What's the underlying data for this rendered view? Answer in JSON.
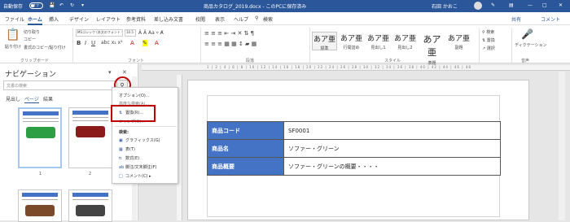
{
  "titlebar": {
    "autosave": "自動保存",
    "autosave_state": "オフ",
    "title": "商品カタログ_2019.docx - このPCに保存済み",
    "user": "石田 かおこ",
    "accent": "#2b579a"
  },
  "menu": {
    "items": [
      "ファイル",
      "ホーム",
      "挿入",
      "デザイン",
      "レイアウト",
      "参考資料",
      "差し込み文書",
      "校閲",
      "表示",
      "ヘルプ",
      "検索"
    ],
    "active": "ホーム",
    "share": "共有",
    "comment": "コメント"
  },
  "ribbon": {
    "clipboard": {
      "paste": "貼り付け",
      "cut": "切り取り",
      "copy": "コピー",
      "format_painter": "書式のコピー/貼り付け",
      "label": "クリップボード"
    },
    "font": {
      "name": "MSゴシック (本文のフォント - 日本語)",
      "size": "10.5",
      "label": "フォント"
    },
    "paragraph": {
      "label": "段落"
    },
    "styles": {
      "label": "スタイル",
      "items": [
        {
          "big": "あア亜",
          "small": "標準"
        },
        {
          "big": "あア亜",
          "small": "行間詰め"
        },
        {
          "big": "あア亜",
          "small": "見出し1"
        },
        {
          "big": "あア亜",
          "small": "見出し2"
        },
        {
          "big": "あア亜",
          "small": "表題"
        },
        {
          "big": "あア亜",
          "small": "副題"
        }
      ]
    },
    "editing": {
      "find": "検索",
      "replace": "置換",
      "select": "選択"
    },
    "voice": {
      "dictate": "ディクテーション",
      "label": "音声"
    }
  },
  "nav": {
    "title": "ナビゲーション",
    "search_placeholder": "文書の検索",
    "tabs": [
      "見出し",
      "ページ",
      "結果"
    ],
    "active_tab": "ページ",
    "page_numbers": [
      "1",
      "2"
    ]
  },
  "search_menu": {
    "options": "オプション(O)...",
    "advanced_find": "高度な検索(A)...",
    "replace": "置換(R)...",
    "goto": "ジャンプ(G)...",
    "find_header": "検索:",
    "graphics": "グラフィックス(G)",
    "tables": "表(T)",
    "equations": "数式(E)",
    "footnotes": "脚注/文末脚注(F)",
    "comments": "コメント(C)"
  },
  "document": {
    "rows": [
      {
        "key": "商品コード",
        "value": "SF0001"
      },
      {
        "key": "商品名",
        "value": "ソファー・グリーン"
      },
      {
        "key": "商品概要",
        "value": "ソファー・グリーンの概要・・・・"
      }
    ],
    "header_color": "#4472c4",
    "highlight_color": "#c00000"
  }
}
